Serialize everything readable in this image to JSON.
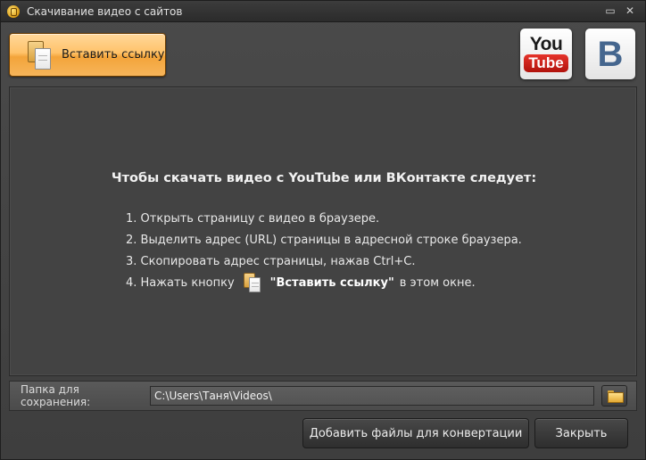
{
  "window": {
    "title": "Скачивание видео с сайтов",
    "minimize_glyph": "▭",
    "close_glyph": "✕"
  },
  "toolbar": {
    "paste_label": "Вставить ссылку"
  },
  "logos": {
    "youtube_you": "You",
    "youtube_tube": "Tube",
    "vk_letter": "B"
  },
  "instructions": {
    "heading": "Чтобы скачать видео с YouTube или ВКонтакте следует:",
    "step1": "1. Открыть страницу с видео в браузере.",
    "step2": "2. Выделить адрес (URL) страницы в адресной строке браузера.",
    "step3": "3. Скопировать адрес страницы, нажав Ctrl+C.",
    "step4_prefix": "4. Нажать кнопку",
    "step4_bold": "\"Вставить ссылку\"",
    "step4_suffix": "в этом окне."
  },
  "save_folder": {
    "label": "Папка для сохранения:",
    "value": "C:\\Users\\Таня\\Videos\\"
  },
  "footer": {
    "convert_label": "Добавить файлы для конвертации",
    "close_label": "Закрыть"
  },
  "colors": {
    "accent_orange": "#f7b55a",
    "youtube_red": "#e5332a",
    "vk_blue": "#45668e",
    "panel_bg": "#434343"
  },
  "icons": {
    "app": "app-icon",
    "paste": "clipboard-paste-icon",
    "folder": "folder-open-icon"
  }
}
